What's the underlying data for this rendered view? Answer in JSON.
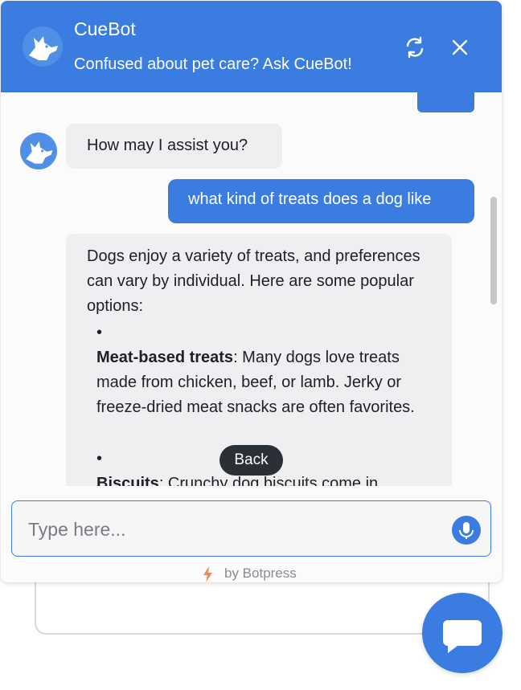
{
  "header": {
    "title": "CueBot",
    "subtitle": "Confused about pet care? Ask CueBot!"
  },
  "messages": {
    "bot_greeting": "How may I assist you?",
    "user_message": "what kind of treats does a dog like",
    "bot_reply_intro": "Dogs enjoy a variety of treats, and preferences can vary by individual. Here are some popular options:",
    "items": [
      {
        "title": "Meat-based treats",
        "text": ": Many dogs love treats made from chicken, beef, or lamb. Jerky or freeze-dried meat snacks are often favorites."
      },
      {
        "title": "Biscuits",
        "text": ": Crunchy dog biscuits come in"
      }
    ]
  },
  "back_button": "Back",
  "composer": {
    "placeholder": "Type here..."
  },
  "footer": {
    "powered_by": "by Botpress"
  },
  "colors": {
    "accent": "#3a7ce0",
    "bot_bubble": "#efeff1",
    "dark": "#2b2f36"
  },
  "icons": {
    "avatar": "dog-icon",
    "refresh": "refresh-icon",
    "close": "close-icon",
    "mic": "microphone-icon",
    "bolt": "bolt-icon",
    "fab": "chat-bubble-icon"
  }
}
